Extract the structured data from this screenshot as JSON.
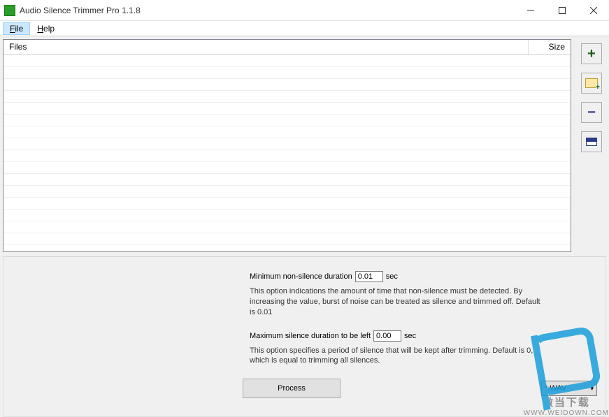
{
  "window": {
    "title": "Audio Silence Trimmer Pro 1.1.8"
  },
  "menu": {
    "file": "File",
    "help": "Help"
  },
  "filelist": {
    "col_files": "Files",
    "col_size": "Size"
  },
  "options": {
    "min_label": "Minimum non-silence duration",
    "min_value": "0.01",
    "sec": "sec",
    "min_desc": "This option indications the amount of time that non-silence must be detected. By increasing the value, burst of noise can be treated as silence and trimmed off. Default is 0.01",
    "max_label": "Maximum silence duration to be left",
    "max_value": "0.00",
    "max_desc": "This option specifies a period of silence that will be kept after trimming. Default is 0, which is equal to trimming all silences."
  },
  "buttons": {
    "process": "Process"
  },
  "format": {
    "selected": "*.WAV"
  },
  "watermark": {
    "cn": "微当下载",
    "url": "WWW.WEIDOWN.COM"
  },
  "side": {
    "add_file": "add-file",
    "add_folder": "add-folder",
    "remove": "remove",
    "clear": "clear-all"
  }
}
